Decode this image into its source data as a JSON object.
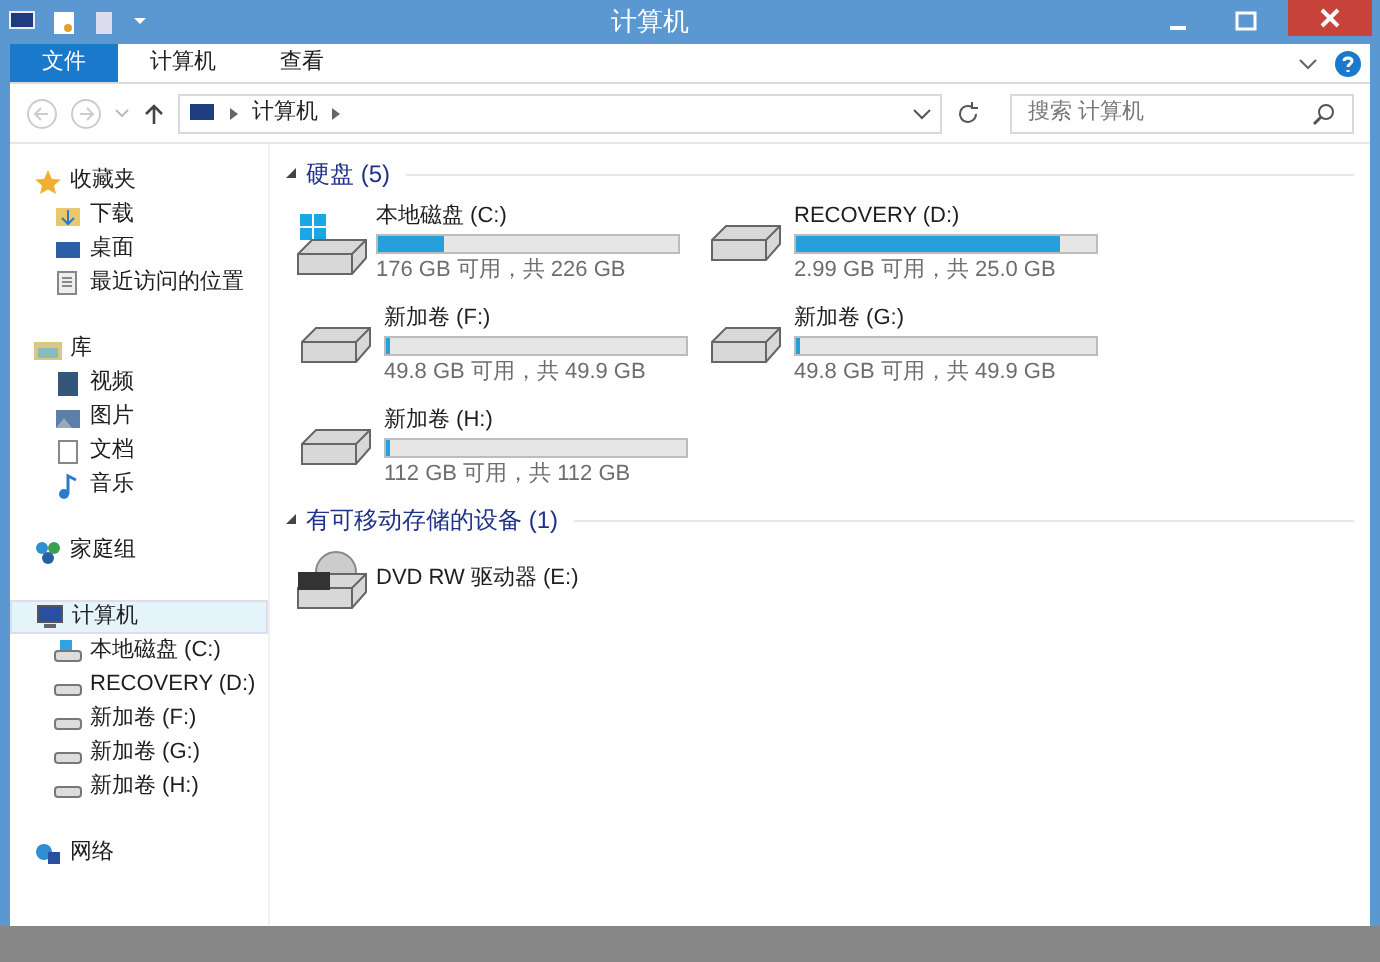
{
  "window": {
    "title": "计算机"
  },
  "ribbon_tabs": [
    {
      "label": "文件",
      "kind": "file",
      "selected": false
    },
    {
      "label": "计算机",
      "kind": "tab",
      "selected": false
    },
    {
      "label": "查看",
      "kind": "tab",
      "selected": false
    }
  ],
  "address_bar": {
    "crumbs": [
      "计算机"
    ]
  },
  "search": {
    "placeholder": "搜索 计算机"
  },
  "sidebar": [
    {
      "label": "收藏夹",
      "kind": "star",
      "selected": false,
      "children": [
        {
          "label": "下载",
          "kind": "download"
        },
        {
          "label": "桌面",
          "kind": "desktop"
        },
        {
          "label": "最近访问的位置",
          "kind": "recent"
        }
      ]
    },
    {
      "label": "库",
      "kind": "library",
      "selected": false,
      "children": [
        {
          "label": "视频",
          "kind": "video"
        },
        {
          "label": "图片",
          "kind": "picture"
        },
        {
          "label": "文档",
          "kind": "document"
        },
        {
          "label": "音乐",
          "kind": "music"
        }
      ]
    },
    {
      "label": "家庭组",
      "kind": "homegroup",
      "selected": false
    },
    {
      "label": "计算机",
      "kind": "computer",
      "selected": true,
      "children": [
        {
          "label": "本地磁盘 (C:)",
          "kind": "system"
        },
        {
          "label": "RECOVERY (D:)",
          "kind": "drive"
        },
        {
          "label": "新加卷 (F:)",
          "kind": "drive"
        },
        {
          "label": "新加卷 (G:)",
          "kind": "drive"
        },
        {
          "label": "新加卷 (H:)",
          "kind": "drive"
        }
      ]
    },
    {
      "label": "网络",
      "kind": "network",
      "selected": false
    }
  ],
  "groups": [
    {
      "title": "硬盘 (5)",
      "items": [
        {
          "kind": "disk",
          "system": true,
          "name": "本地磁盘 (C:)",
          "level": 0.22,
          "info": "176 GB 可用，共 226 GB"
        },
        {
          "kind": "disk",
          "system": false,
          "name": "RECOVERY (D:)",
          "level": 0.88,
          "info": "2.99 GB 可用，共 25.0 GB"
        },
        {
          "kind": "disk",
          "system": false,
          "name": "新加卷 (F:)",
          "level": 0.01,
          "info": "49.8 GB 可用，共 49.9 GB"
        },
        {
          "kind": "disk",
          "system": false,
          "name": "新加卷 (G:)",
          "level": 0.01,
          "info": "49.8 GB 可用，共 49.9 GB"
        },
        {
          "kind": "disk",
          "system": false,
          "name": "新加卷 (H:)",
          "level": 0.01,
          "info": "112 GB 可用，共 112 GB"
        }
      ]
    },
    {
      "title": "有可移动存储的设备 (1)",
      "items": [
        {
          "kind": "dvd",
          "name": "DVD RW 驱动器 (E:)"
        }
      ]
    }
  ]
}
